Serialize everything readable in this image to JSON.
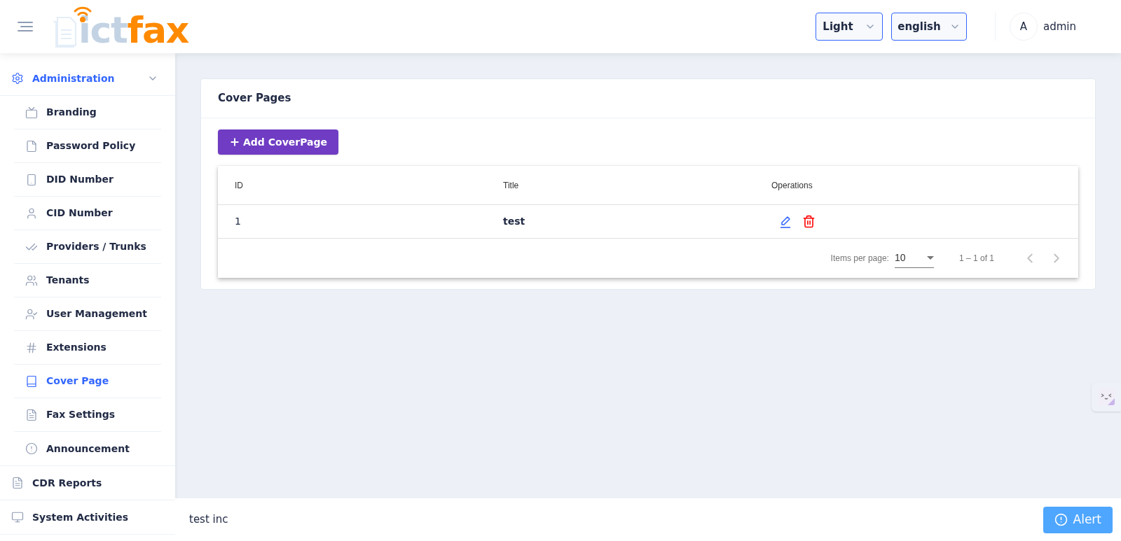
{
  "header": {
    "logo": {
      "part_1": "ict",
      "part_2": "fax"
    },
    "theme_select": {
      "value": "Light"
    },
    "language_select": {
      "value": "english"
    },
    "user": {
      "avatar_letter": "A",
      "name": "admin"
    }
  },
  "sidebar": {
    "items": [
      {
        "label": "Administration",
        "kind": "gear",
        "selected": false,
        "expanded": true,
        "children": [
          {
            "label": "Branding",
            "kind": "tv",
            "selected": false
          },
          {
            "label": "Password Policy",
            "kind": "file",
            "selected": false
          },
          {
            "label": "DID Number",
            "kind": "phone",
            "selected": false
          },
          {
            "label": "CID Number",
            "kind": "user",
            "selected": false
          },
          {
            "label": "Providers / Trunks",
            "kind": "checks",
            "selected": false
          },
          {
            "label": "Tenants",
            "kind": "users",
            "selected": false
          },
          {
            "label": "User Management",
            "kind": "usercheck",
            "selected": false
          },
          {
            "label": "Extensions",
            "kind": "hash",
            "selected": false
          },
          {
            "label": "Cover Page",
            "kind": "book",
            "selected": true
          },
          {
            "label": "Fax Settings",
            "kind": "filetext",
            "selected": false
          },
          {
            "label": "Announcement",
            "kind": "alert",
            "selected": false
          }
        ]
      },
      {
        "label": "CDR Reports",
        "kind": "filetext",
        "selected": false
      },
      {
        "label": "System Activities",
        "kind": "monitor",
        "selected": false
      }
    ]
  },
  "card": {
    "title": "Cover Pages",
    "add_button": "Add CoverPage",
    "table": {
      "columns": [
        "ID",
        "Title",
        "Operations"
      ],
      "rows": [
        {
          "id": "1",
          "title": "test"
        }
      ],
      "paginator": {
        "label": "Items per page:",
        "page_size": "10",
        "range": "1 – 1 of 1"
      }
    }
  },
  "footer": {
    "text": "test inc",
    "alert_button": "Alert"
  }
}
